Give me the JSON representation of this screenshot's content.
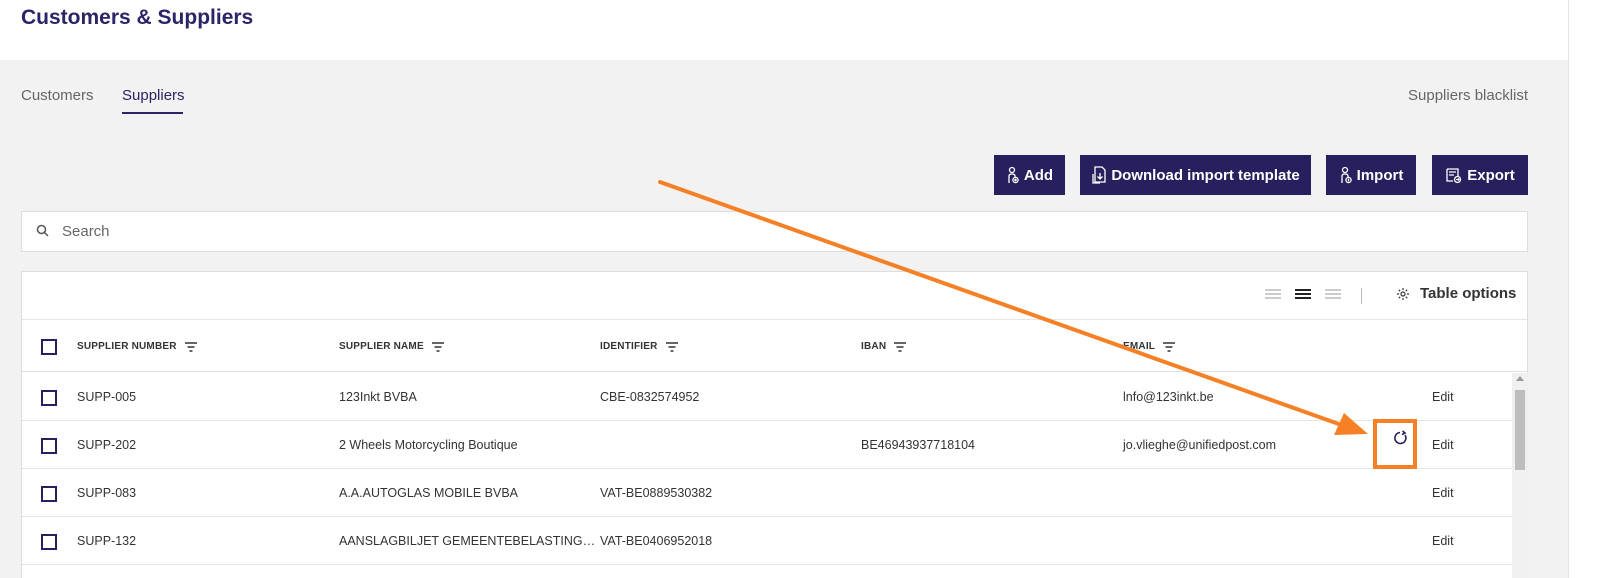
{
  "header": {
    "title": "Customers & Suppliers"
  },
  "tabs": [
    {
      "label": "Customers",
      "active": false
    },
    {
      "label": "Suppliers",
      "active": true
    }
  ],
  "blacklist_link": "Suppliers blacklist",
  "actions": {
    "add": "Add",
    "download_template": "Download import template",
    "import": "Import",
    "export": "Export"
  },
  "search": {
    "placeholder": "Search",
    "value": ""
  },
  "table_options_label": "Table options",
  "columns": {
    "supplier_number": "SUPPLIER NUMBER",
    "supplier_name": "SUPPLIER NAME",
    "identifier": "IDENTIFIER",
    "iban": "IBAN",
    "email": "EMAIL"
  },
  "rows": [
    {
      "number": "SUPP-005",
      "name": "123Inkt BVBA",
      "identifier": "CBE-0832574952",
      "iban": "",
      "email": "lnfo@123inkt.be",
      "edit": "Edit"
    },
    {
      "number": "SUPP-202",
      "name": "2 Wheels Motorcycling Boutique",
      "identifier": "",
      "iban": "BE46943937718104",
      "email": "jo.vlieghe@unifiedpost.com",
      "edit": "Edit"
    },
    {
      "number": "SUPP-083",
      "name": "A.A.AUTOGLAS MOBILE BVBA",
      "identifier": "VAT-BE0889530382",
      "iban": "",
      "email": "",
      "edit": "Edit"
    },
    {
      "number": "SUPP-132",
      "name": "AANSLAGBILJET GEMEENTEBELASTING…",
      "identifier": "VAT-BE0406952018",
      "iban": "",
      "email": "",
      "edit": "Edit"
    }
  ],
  "colors": {
    "primary": "#26215e",
    "title": "#2b2466",
    "annotation": "#f58025"
  }
}
